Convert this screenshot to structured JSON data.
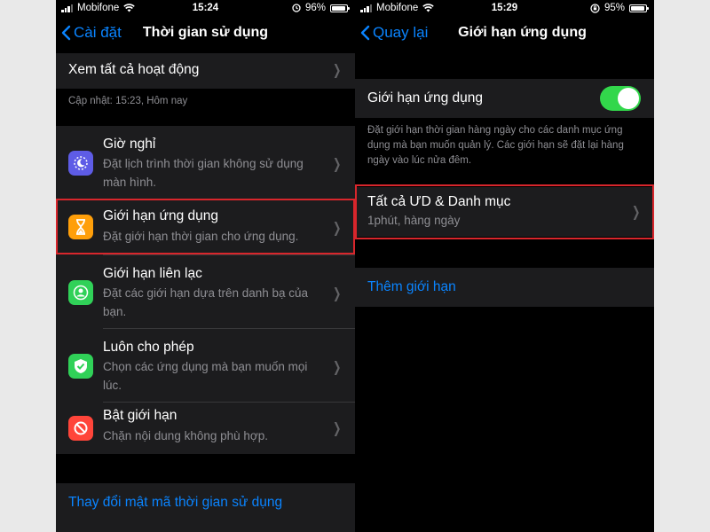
{
  "left_screen": {
    "status": {
      "carrier": "Mobifone",
      "time": "15:24",
      "battery": "96%",
      "battery_level": 0.96
    },
    "nav": {
      "back_label": "Cài đặt",
      "title": "Thời gian sử dụng"
    },
    "see_all_activity": "Xem tất cả hoạt động",
    "update_note": "Cập nhật: 15:23, Hôm nay",
    "items": [
      {
        "title": "Giờ nghỉ",
        "subtitle": "Đặt lịch trình thời gian không sử dụng màn hình.",
        "icon": "moon-icon",
        "color": "#5e5ce6"
      },
      {
        "title": "Giới hạn ứng dụng",
        "subtitle": "Đặt giới hạn thời gian cho ứng dụng.",
        "icon": "hourglass-icon",
        "color": "#ff9f0a"
      },
      {
        "title": "Giới hạn liên lạc",
        "subtitle": "Đặt các giới hạn dựa trên danh bạ của bạn.",
        "icon": "contact-icon",
        "color": "#30d158"
      },
      {
        "title": "Luôn cho phép",
        "subtitle": "Chọn các ứng dụng mà bạn muốn mọi lúc.",
        "icon": "checkmark-shield-icon",
        "color": "#30d158"
      },
      {
        "title": "Bật giới hạn",
        "subtitle": "Chặn nội dung không phù hợp.",
        "icon": "restriction-icon",
        "color": "#ff453a"
      }
    ],
    "change_passcode": "Thay đổi mật mã thời gian sử dụng"
  },
  "right_screen": {
    "status": {
      "carrier": "Mobifone",
      "time": "15:29",
      "battery": "95%",
      "battery_level": 0.95
    },
    "nav": {
      "back_label": "Quay lại",
      "title": "Giới hạn ứng dụng"
    },
    "toggle_label": "Giới hạn ứng dụng",
    "toggle_on": true,
    "description": "Đặt giới hạn thời gian hàng ngày cho các danh mục ứng dụng mà bạn muốn quản lý. Các giới hạn sẽ đặt lại hàng ngày vào lúc nửa đêm.",
    "limit_item": {
      "title": "Tất cả ƯD & Danh mục",
      "subtitle": "1phút, hàng ngày"
    },
    "add_limit": "Thêm giới hạn"
  },
  "colors": {
    "accent": "#0a84ff",
    "highlight": "#d8262c",
    "toggle": "#32d74b"
  }
}
